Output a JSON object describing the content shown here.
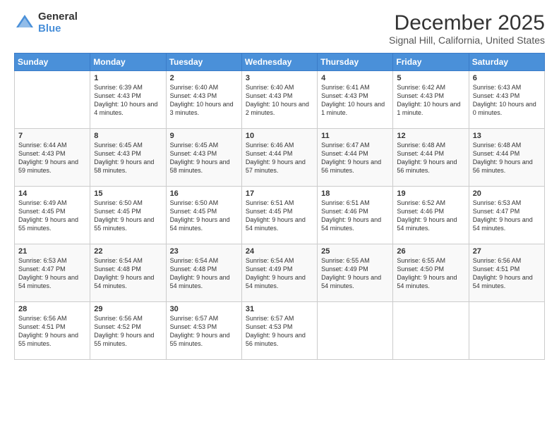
{
  "logo": {
    "general": "General",
    "blue": "Blue"
  },
  "header": {
    "title": "December 2025",
    "subtitle": "Signal Hill, California, United States"
  },
  "weekdays": [
    "Sunday",
    "Monday",
    "Tuesday",
    "Wednesday",
    "Thursday",
    "Friday",
    "Saturday"
  ],
  "weeks": [
    [
      {
        "day": "",
        "sunrise": "",
        "sunset": "",
        "daylight": ""
      },
      {
        "day": "1",
        "sunrise": "Sunrise: 6:39 AM",
        "sunset": "Sunset: 4:43 PM",
        "daylight": "Daylight: 10 hours and 4 minutes."
      },
      {
        "day": "2",
        "sunrise": "Sunrise: 6:40 AM",
        "sunset": "Sunset: 4:43 PM",
        "daylight": "Daylight: 10 hours and 3 minutes."
      },
      {
        "day": "3",
        "sunrise": "Sunrise: 6:40 AM",
        "sunset": "Sunset: 4:43 PM",
        "daylight": "Daylight: 10 hours and 2 minutes."
      },
      {
        "day": "4",
        "sunrise": "Sunrise: 6:41 AM",
        "sunset": "Sunset: 4:43 PM",
        "daylight": "Daylight: 10 hours and 1 minute."
      },
      {
        "day": "5",
        "sunrise": "Sunrise: 6:42 AM",
        "sunset": "Sunset: 4:43 PM",
        "daylight": "Daylight: 10 hours and 1 minute."
      },
      {
        "day": "6",
        "sunrise": "Sunrise: 6:43 AM",
        "sunset": "Sunset: 4:43 PM",
        "daylight": "Daylight: 10 hours and 0 minutes."
      }
    ],
    [
      {
        "day": "7",
        "sunrise": "Sunrise: 6:44 AM",
        "sunset": "Sunset: 4:43 PM",
        "daylight": "Daylight: 9 hours and 59 minutes."
      },
      {
        "day": "8",
        "sunrise": "Sunrise: 6:45 AM",
        "sunset": "Sunset: 4:43 PM",
        "daylight": "Daylight: 9 hours and 58 minutes."
      },
      {
        "day": "9",
        "sunrise": "Sunrise: 6:45 AM",
        "sunset": "Sunset: 4:43 PM",
        "daylight": "Daylight: 9 hours and 58 minutes."
      },
      {
        "day": "10",
        "sunrise": "Sunrise: 6:46 AM",
        "sunset": "Sunset: 4:44 PM",
        "daylight": "Daylight: 9 hours and 57 minutes."
      },
      {
        "day": "11",
        "sunrise": "Sunrise: 6:47 AM",
        "sunset": "Sunset: 4:44 PM",
        "daylight": "Daylight: 9 hours and 56 minutes."
      },
      {
        "day": "12",
        "sunrise": "Sunrise: 6:48 AM",
        "sunset": "Sunset: 4:44 PM",
        "daylight": "Daylight: 9 hours and 56 minutes."
      },
      {
        "day": "13",
        "sunrise": "Sunrise: 6:48 AM",
        "sunset": "Sunset: 4:44 PM",
        "daylight": "Daylight: 9 hours and 56 minutes."
      }
    ],
    [
      {
        "day": "14",
        "sunrise": "Sunrise: 6:49 AM",
        "sunset": "Sunset: 4:45 PM",
        "daylight": "Daylight: 9 hours and 55 minutes."
      },
      {
        "day": "15",
        "sunrise": "Sunrise: 6:50 AM",
        "sunset": "Sunset: 4:45 PM",
        "daylight": "Daylight: 9 hours and 55 minutes."
      },
      {
        "day": "16",
        "sunrise": "Sunrise: 6:50 AM",
        "sunset": "Sunset: 4:45 PM",
        "daylight": "Daylight: 9 hours and 54 minutes."
      },
      {
        "day": "17",
        "sunrise": "Sunrise: 6:51 AM",
        "sunset": "Sunset: 4:45 PM",
        "daylight": "Daylight: 9 hours and 54 minutes."
      },
      {
        "day": "18",
        "sunrise": "Sunrise: 6:51 AM",
        "sunset": "Sunset: 4:46 PM",
        "daylight": "Daylight: 9 hours and 54 minutes."
      },
      {
        "day": "19",
        "sunrise": "Sunrise: 6:52 AM",
        "sunset": "Sunset: 4:46 PM",
        "daylight": "Daylight: 9 hours and 54 minutes."
      },
      {
        "day": "20",
        "sunrise": "Sunrise: 6:53 AM",
        "sunset": "Sunset: 4:47 PM",
        "daylight": "Daylight: 9 hours and 54 minutes."
      }
    ],
    [
      {
        "day": "21",
        "sunrise": "Sunrise: 6:53 AM",
        "sunset": "Sunset: 4:47 PM",
        "daylight": "Daylight: 9 hours and 54 minutes."
      },
      {
        "day": "22",
        "sunrise": "Sunrise: 6:54 AM",
        "sunset": "Sunset: 4:48 PM",
        "daylight": "Daylight: 9 hours and 54 minutes."
      },
      {
        "day": "23",
        "sunrise": "Sunrise: 6:54 AM",
        "sunset": "Sunset: 4:48 PM",
        "daylight": "Daylight: 9 hours and 54 minutes."
      },
      {
        "day": "24",
        "sunrise": "Sunrise: 6:54 AM",
        "sunset": "Sunset: 4:49 PM",
        "daylight": "Daylight: 9 hours and 54 minutes."
      },
      {
        "day": "25",
        "sunrise": "Sunrise: 6:55 AM",
        "sunset": "Sunset: 4:49 PM",
        "daylight": "Daylight: 9 hours and 54 minutes."
      },
      {
        "day": "26",
        "sunrise": "Sunrise: 6:55 AM",
        "sunset": "Sunset: 4:50 PM",
        "daylight": "Daylight: 9 hours and 54 minutes."
      },
      {
        "day": "27",
        "sunrise": "Sunrise: 6:56 AM",
        "sunset": "Sunset: 4:51 PM",
        "daylight": "Daylight: 9 hours and 54 minutes."
      }
    ],
    [
      {
        "day": "28",
        "sunrise": "Sunrise: 6:56 AM",
        "sunset": "Sunset: 4:51 PM",
        "daylight": "Daylight: 9 hours and 55 minutes."
      },
      {
        "day": "29",
        "sunrise": "Sunrise: 6:56 AM",
        "sunset": "Sunset: 4:52 PM",
        "daylight": "Daylight: 9 hours and 55 minutes."
      },
      {
        "day": "30",
        "sunrise": "Sunrise: 6:57 AM",
        "sunset": "Sunset: 4:53 PM",
        "daylight": "Daylight: 9 hours and 55 minutes."
      },
      {
        "day": "31",
        "sunrise": "Sunrise: 6:57 AM",
        "sunset": "Sunset: 4:53 PM",
        "daylight": "Daylight: 9 hours and 56 minutes."
      },
      {
        "day": "",
        "sunrise": "",
        "sunset": "",
        "daylight": ""
      },
      {
        "day": "",
        "sunrise": "",
        "sunset": "",
        "daylight": ""
      },
      {
        "day": "",
        "sunrise": "",
        "sunset": "",
        "daylight": ""
      }
    ]
  ]
}
